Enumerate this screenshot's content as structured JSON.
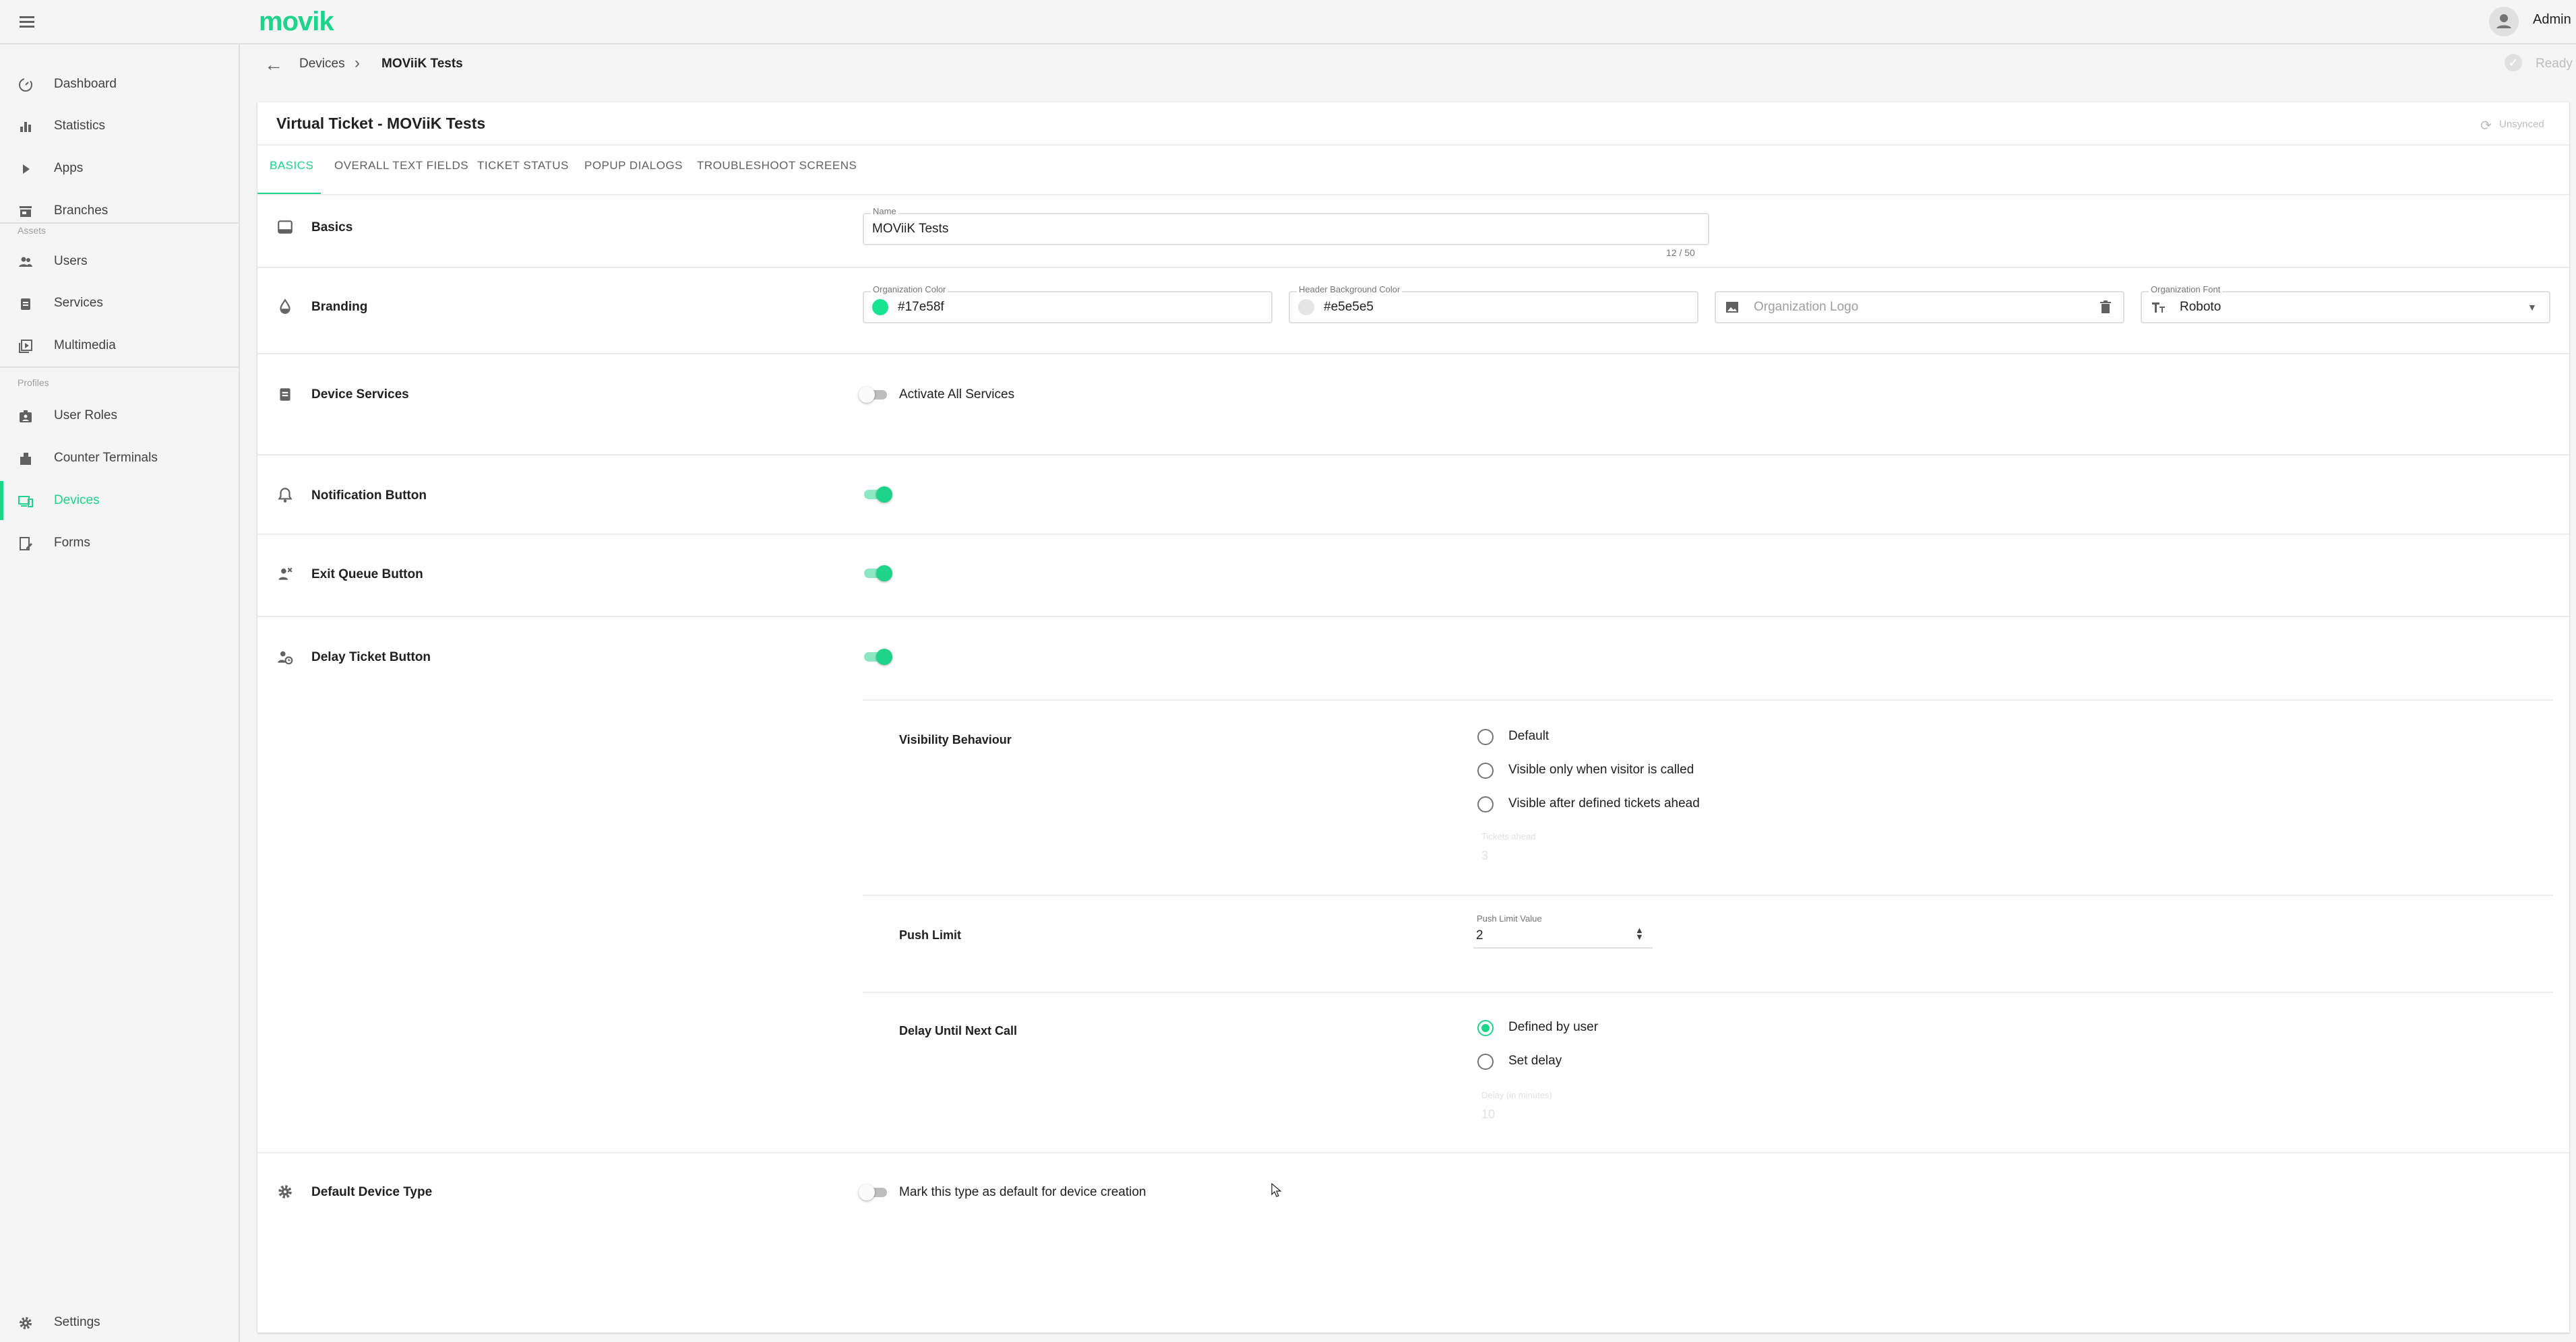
{
  "app": {
    "logo": "movik",
    "user": "Admin"
  },
  "sidebar": {
    "items": [
      {
        "label": "Dashboard",
        "icon": "dashboard-icon"
      },
      {
        "label": "Statistics",
        "icon": "bar-chart-icon"
      },
      {
        "label": "Apps",
        "icon": "play-icon"
      },
      {
        "label": "Branches",
        "icon": "store-icon"
      }
    ],
    "assets_label": "Assets",
    "assets": [
      {
        "label": "Users",
        "icon": "users-icon"
      },
      {
        "label": "Services",
        "icon": "clipboard-icon"
      },
      {
        "label": "Multimedia",
        "icon": "media-icon"
      }
    ],
    "profiles_label": "Profiles",
    "profiles": [
      {
        "label": "User Roles",
        "icon": "badge-icon"
      },
      {
        "label": "Counter Terminals",
        "icon": "terminal-icon"
      },
      {
        "label": "Devices",
        "icon": "devices-icon",
        "active": true
      },
      {
        "label": "Forms",
        "icon": "form-icon"
      }
    ],
    "settings": {
      "label": "Settings",
      "icon": "gear-icon"
    }
  },
  "breadcrumb": {
    "parent": "Devices",
    "current": "MOViiK Tests",
    "status": "Ready"
  },
  "card": {
    "title": "Virtual Ticket -  MOViiK Tests",
    "sync_status": "Unsynced",
    "tabs": [
      "BASICS",
      "OVERALL TEXT FIELDS",
      "TICKET STATUS",
      "POPUP DIALOGS",
      "TROUBLESHOOT SCREENS"
    ],
    "active_tab": "BASICS"
  },
  "basics": {
    "title": "Basics",
    "name_label": "Name",
    "name_value": "MOViiK Tests",
    "name_counter": "12 / 50"
  },
  "branding": {
    "title": "Branding",
    "org_color_label": "Organization Color",
    "org_color_value": "#17e58f",
    "org_color_swatch": "#17e58f",
    "header_bg_label": "Header Background Color",
    "header_bg_value": "#e5e5e5",
    "header_bg_swatch": "#e5e5e5",
    "logo_placeholder": "Organization Logo",
    "font_label": "Organization Font",
    "font_value": "Roboto"
  },
  "device_services": {
    "title": "Device Services",
    "toggle_label": "Activate All Services",
    "enabled": false
  },
  "notification_button": {
    "title": "Notification Button",
    "enabled": true
  },
  "exit_queue_button": {
    "title": "Exit Queue Button",
    "enabled": true
  },
  "delay_ticket_button": {
    "title": "Delay Ticket Button",
    "enabled": true,
    "visibility": {
      "title": "Visibility Behaviour",
      "options": [
        "Default",
        "Visible only when visitor is called",
        "Visible after defined tickets ahead"
      ],
      "tickets_ahead_label": "Tickets ahead",
      "tickets_ahead_value": "3"
    },
    "push_limit": {
      "title": "Push Limit",
      "label": "Push Limit Value",
      "value": "2"
    },
    "delay_next_call": {
      "title": "Delay Until Next Call",
      "options": [
        "Defined by user",
        "Set delay"
      ],
      "selected": "Defined by user",
      "delay_label": "Delay (in minutes)",
      "delay_value": "10"
    }
  },
  "default_device_type": {
    "title": "Default Device Type",
    "toggle_label": "Mark this type as default for device creation",
    "enabled": false
  },
  "colors": {
    "accent": "#1ed38a",
    "text": "#212121",
    "muted": "#757575",
    "border": "#e0e0e0"
  }
}
